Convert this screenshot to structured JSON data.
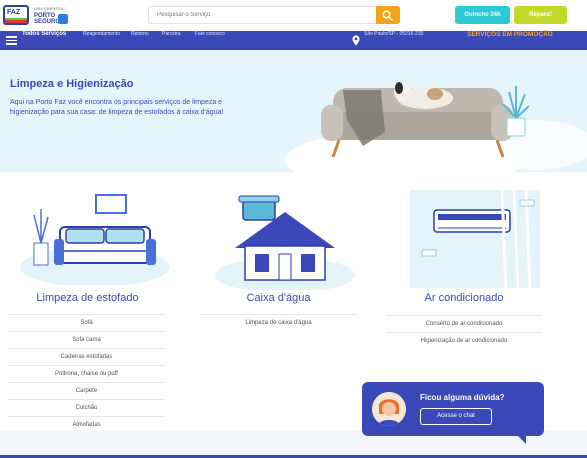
{
  "header": {
    "logo_text": "FAZ",
    "partner_small": "UMA EMPRESA",
    "partner_brand": "PORTO SEGURO",
    "search_placeholder": "Pesquisar o Serviço",
    "guincho_label": "Guincho 24h",
    "reparo_label": "Reparo!"
  },
  "nav": {
    "all_services": "Todos Serviços",
    "links": [
      "Reagendamento",
      "Retorno",
      "Parceira",
      "Fale conosco"
    ],
    "location": "São Paulo/SP - 05216-230",
    "promo": "SERVIÇOS EM PROMOÇÃO"
  },
  "hero": {
    "title": "Limpeza e Higienização",
    "description": "Aqui na Porto Faz você encontra os principais serviços de limpeza e higienização para sua casa: de limpeza de estofados à caixa d'água!"
  },
  "categories": [
    {
      "title": "Limpeza de estofado",
      "icon": "sofa-icon",
      "items": [
        "Sofá",
        "Sofá cama",
        "Cadeiras estofadas",
        "Poltrona, chaise ou puff",
        "Carpete",
        "Colchão",
        "Almofadas"
      ]
    },
    {
      "title": "Caixa d'água",
      "icon": "water-tank-house-icon",
      "items": [
        "Limpeza de caixa d'água"
      ]
    },
    {
      "title": "Ar condicionado",
      "icon": "air-conditioner-icon",
      "items": [
        "Conserto de ar condicionado",
        "Higienização de ar condicionado"
      ]
    }
  ],
  "chat": {
    "question": "Ficou alguma dúvida?",
    "cta": "Acesse o chat"
  },
  "colors": {
    "brand_blue": "#3b49b8",
    "accent_orange": "#f5a31a",
    "teal": "#2ec8d6",
    "lime": "#c2d82b",
    "hero_bg": "#e4f6fc"
  }
}
